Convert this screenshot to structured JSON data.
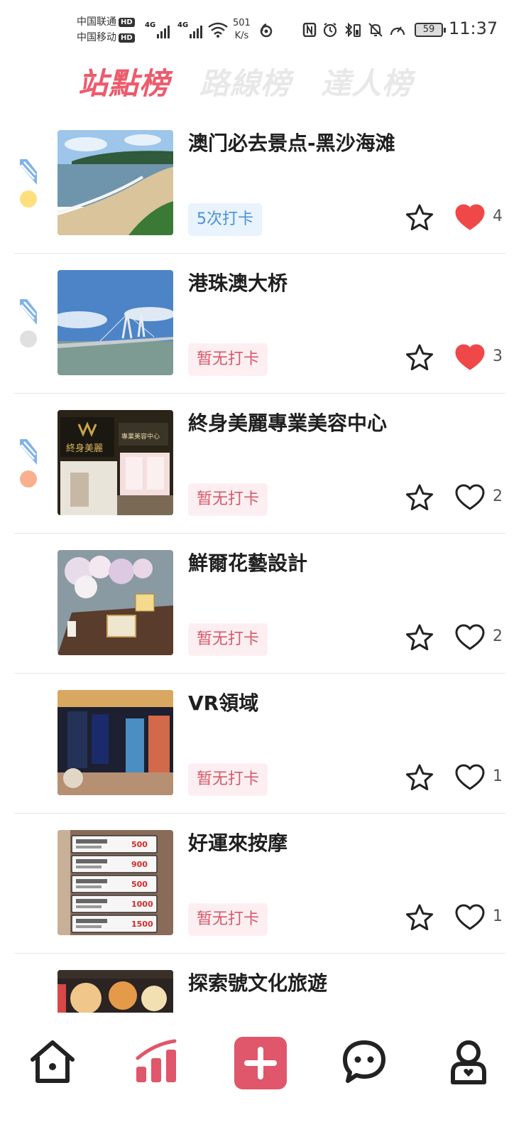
{
  "status_bar": {
    "carrier1": "中国联通",
    "carrier2": "中国移动",
    "hd_label": "HD",
    "net1": "4G",
    "net2": "4G",
    "net_speed_value": "501",
    "net_speed_unit": "K/s",
    "battery": "59",
    "time": "11:37"
  },
  "tabs": [
    {
      "label": "站點榜",
      "active": true
    },
    {
      "label": "路線榜",
      "active": false
    },
    {
      "label": "達人榜",
      "active": false
    }
  ],
  "colors": {
    "accent": "#ee5b6c",
    "gold": "#fde07d",
    "silver": "#e0e0e0",
    "bronze": "#f9b08e",
    "heart_filled": "#f04848"
  },
  "items": [
    {
      "title": "澳门必去景点-黑沙海滩",
      "badge": "5次打卡",
      "badge_type": "checked",
      "likes": "4",
      "liked": true,
      "rank_medal": "gold",
      "thumb": "beach"
    },
    {
      "title": "港珠澳大桥",
      "badge": "暂无打卡",
      "badge_type": "none",
      "likes": "3",
      "liked": true,
      "rank_medal": "silver",
      "thumb": "bridge"
    },
    {
      "title": "終身美麗專業美容中心",
      "badge": "暂无打卡",
      "badge_type": "none",
      "likes": "2",
      "liked": false,
      "rank_medal": "bronze",
      "thumb": "salon"
    },
    {
      "title": "鮮爾花藝設計",
      "badge": "暂无打卡",
      "badge_type": "none",
      "likes": "2",
      "liked": false,
      "rank_medal": null,
      "thumb": "flowers"
    },
    {
      "title": "VR領域",
      "badge": "暂无打卡",
      "badge_type": "none",
      "likes": "1",
      "liked": false,
      "rank_medal": null,
      "thumb": "vr"
    },
    {
      "title": "好運來按摩",
      "badge": "暂无打卡",
      "badge_type": "none",
      "likes": "1",
      "liked": false,
      "rank_medal": null,
      "thumb": "massage"
    },
    {
      "title": "探索號文化旅遊",
      "badge": "",
      "badge_type": "none",
      "likes": "",
      "liked": false,
      "rank_medal": null,
      "thumb": "food"
    }
  ],
  "thumb_text": {
    "salon_sign": "終身美麗",
    "salon_sub": "專業美容中心",
    "massage_prices": [
      "500",
      "900",
      "500",
      "1000",
      "1500"
    ]
  },
  "bottom_nav": {
    "icons": [
      "home-icon",
      "ranking-icon",
      "add-icon",
      "chat-icon",
      "profile-icon"
    ]
  }
}
